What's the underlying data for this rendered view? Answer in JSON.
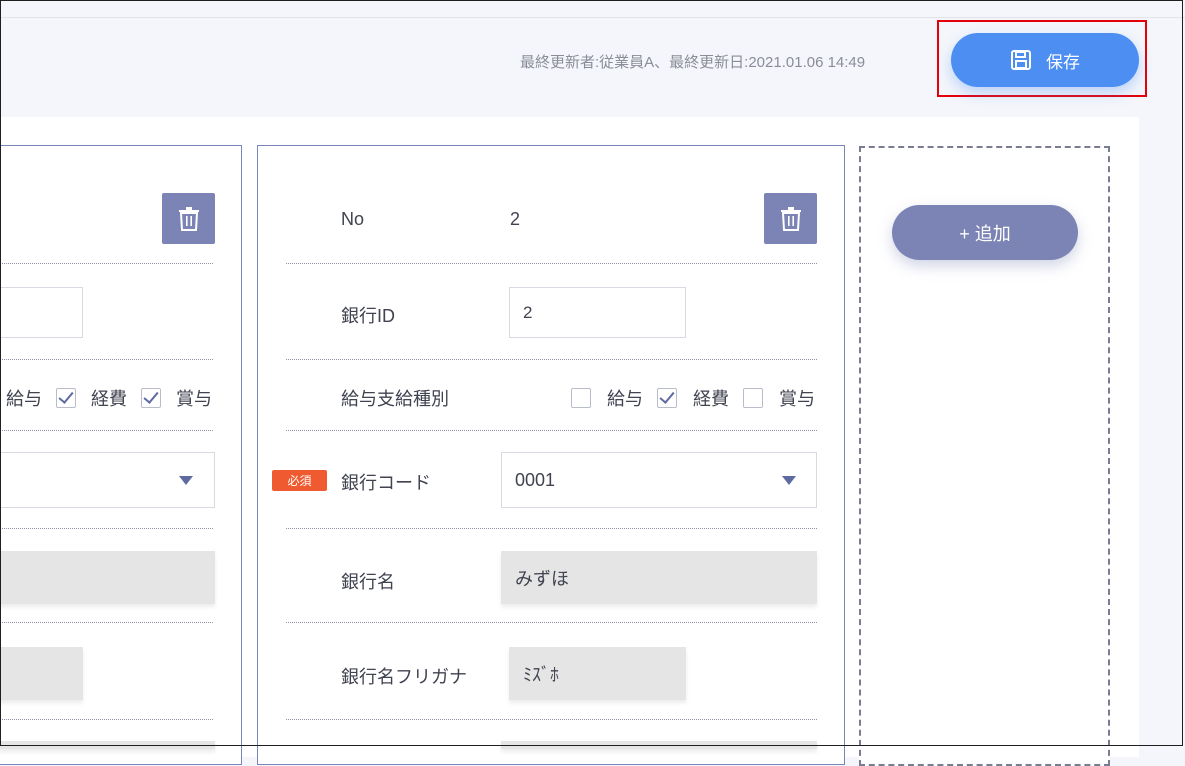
{
  "header": {
    "meta_text": "最終更新者:従業員A、最終更新日:2021.01.06 14:49",
    "save_label": "保存"
  },
  "add_label": "+ 追加",
  "left_card": {
    "payment_options": [
      {
        "label": "給与",
        "checked": false
      },
      {
        "label": "経費",
        "checked": true
      },
      {
        "label": "賞与",
        "checked": true
      }
    ]
  },
  "card": {
    "no_label": "No",
    "no_value": "2",
    "bank_id_label": "銀行ID",
    "bank_id_value": "2",
    "payment_type_label": "給与支給種別",
    "payment_options": [
      {
        "label": "給与",
        "checked": false
      },
      {
        "label": "経費",
        "checked": true
      },
      {
        "label": "賞与",
        "checked": false
      }
    ],
    "required_badge": "必須",
    "bank_code_label": "銀行コード",
    "bank_code_value": "0001",
    "bank_name_label": "銀行名",
    "bank_name_value": "みずほ",
    "bank_kana_label": "銀行名フリガナ",
    "bank_kana_value": "ﾐｽﾞﾎ"
  },
  "colors": {
    "accent": "#4d8ef3",
    "secondary": "#7b84b4",
    "required": "#ef5a30",
    "highlight_border": "#e3000b"
  }
}
